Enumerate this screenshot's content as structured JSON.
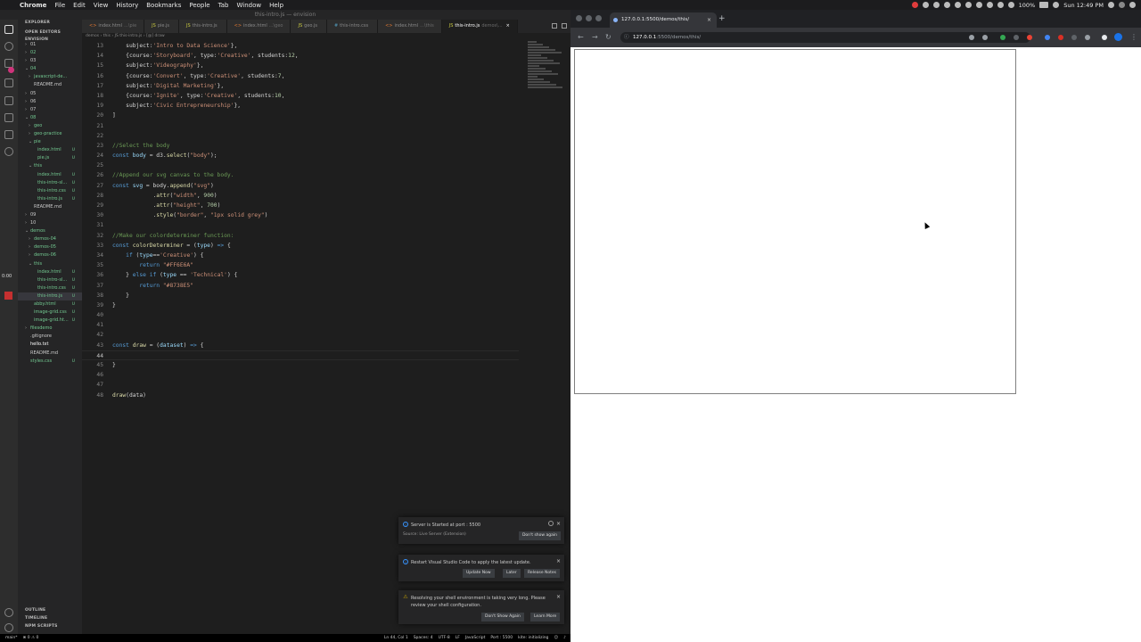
{
  "menubar": {
    "app": "Chrome",
    "items": [
      "File",
      "Edit",
      "View",
      "History",
      "Bookmarks",
      "People",
      "Tab",
      "Window",
      "Help"
    ],
    "battery": "100%",
    "clock": "Sun 12:49 PM"
  },
  "vscode": {
    "title": "this-intro.js — envision",
    "timer": "0:00",
    "explorer_label": "EXPLORER",
    "open_editors_label": "OPEN EDITORS",
    "workspace_label": "ENVISION",
    "tree": [
      {
        "label": "01",
        "indent": 1,
        "color": "#cccccc",
        "arrow": "›",
        "u": ""
      },
      {
        "label": "02",
        "indent": 1,
        "color": "#73c991",
        "arrow": "›",
        "u": ""
      },
      {
        "label": "03",
        "indent": 1,
        "color": "#cccccc",
        "arrow": "›",
        "u": ""
      },
      {
        "label": "04",
        "indent": 1,
        "color": "#73c991",
        "arrow": "⌄",
        "u": ""
      },
      {
        "label": "javascript-de...",
        "indent": 2,
        "color": "#73c991",
        "arrow": "›",
        "u": ""
      },
      {
        "label": "README.md",
        "indent": 2,
        "color": "#cccccc",
        "arrow": "",
        "u": ""
      },
      {
        "label": "05",
        "indent": 1,
        "color": "#cccccc",
        "arrow": "›",
        "u": ""
      },
      {
        "label": "06",
        "indent": 1,
        "color": "#cccccc",
        "arrow": "›",
        "u": ""
      },
      {
        "label": "07",
        "indent": 1,
        "color": "#cccccc",
        "arrow": "›",
        "u": ""
      },
      {
        "label": "08",
        "indent": 1,
        "color": "#73c991",
        "arrow": "⌄",
        "u": ""
      },
      {
        "label": "geo",
        "indent": 2,
        "color": "#73c991",
        "arrow": "›",
        "u": ""
      },
      {
        "label": "geo-practice",
        "indent": 2,
        "color": "#73c991",
        "arrow": "›",
        "u": ""
      },
      {
        "label": "pie",
        "indent": 2,
        "color": "#73c991",
        "arrow": "⌄",
        "u": ""
      },
      {
        "label": "index.html",
        "indent": 3,
        "color": "#73c991",
        "arrow": "",
        "u": "U"
      },
      {
        "label": "pie.js",
        "indent": 3,
        "color": "#73c991",
        "arrow": "",
        "u": "U"
      },
      {
        "label": "this",
        "indent": 2,
        "color": "#73c991",
        "arrow": "⌄",
        "u": ""
      },
      {
        "label": "index.html",
        "indent": 3,
        "color": "#73c991",
        "arrow": "",
        "u": "U"
      },
      {
        "label": "this-intro-sl...",
        "indent": 3,
        "color": "#73c991",
        "arrow": "",
        "u": "U"
      },
      {
        "label": "this-intro.css",
        "indent": 3,
        "color": "#73c991",
        "arrow": "",
        "u": "U"
      },
      {
        "label": "this-intro.js",
        "indent": 3,
        "color": "#73c991",
        "arrow": "",
        "u": "U"
      },
      {
        "label": "README.md",
        "indent": 2,
        "color": "#cccccc",
        "arrow": "",
        "u": ""
      },
      {
        "label": "09",
        "indent": 1,
        "color": "#cccccc",
        "arrow": "›",
        "u": ""
      },
      {
        "label": "10",
        "indent": 1,
        "color": "#cccccc",
        "arrow": "›",
        "u": ""
      },
      {
        "label": "demos",
        "indent": 1,
        "color": "#73c991",
        "arrow": "⌄",
        "u": ""
      },
      {
        "label": "demos-04",
        "indent": 2,
        "color": "#73c991",
        "arrow": "›",
        "u": ""
      },
      {
        "label": "demos-05",
        "indent": 2,
        "color": "#73c991",
        "arrow": "›",
        "u": ""
      },
      {
        "label": "demos-06",
        "indent": 2,
        "color": "#73c991",
        "arrow": "›",
        "u": ""
      },
      {
        "label": "this",
        "indent": 2,
        "color": "#73c991",
        "arrow": "⌄",
        "u": ""
      },
      {
        "label": "index.html",
        "indent": 3,
        "color": "#73c991",
        "arrow": "",
        "u": "U"
      },
      {
        "label": "this-intro-sl...",
        "indent": 3,
        "color": "#73c991",
        "arrow": "",
        "u": "U"
      },
      {
        "label": "this-intro.css",
        "indent": 3,
        "color": "#73c991",
        "arrow": "",
        "u": "U"
      },
      {
        "label": "this-intro.js",
        "indent": 3,
        "color": "#73c991",
        "arrow": "",
        "u": "U",
        "selected": true
      },
      {
        "label": "abby.html",
        "indent": 2,
        "color": "#73c991",
        "arrow": "",
        "u": "U"
      },
      {
        "label": "image-grid.css",
        "indent": 2,
        "color": "#73c991",
        "arrow": "",
        "u": "U"
      },
      {
        "label": "image-grid.ht...",
        "indent": 2,
        "color": "#73c991",
        "arrow": "",
        "u": "U"
      },
      {
        "label": "filesdemo",
        "indent": 1,
        "color": "#73c991",
        "arrow": "›",
        "u": ""
      },
      {
        "label": ".gitignore",
        "indent": 1,
        "color": "#cccccc",
        "arrow": "",
        "u": ""
      },
      {
        "label": "hello.txt",
        "indent": 1,
        "color": "#ffffff",
        "arrow": "",
        "u": ""
      },
      {
        "label": "README.md",
        "indent": 1,
        "color": "#cccccc",
        "arrow": "",
        "u": ""
      },
      {
        "label": "styles.css",
        "indent": 1,
        "color": "#73c991",
        "arrow": "",
        "u": "U"
      }
    ],
    "sidebar_bottom": [
      "OUTLINE",
      "TIMELINE",
      "NPM SCRIPTS"
    ],
    "tabs": [
      {
        "label": "index.html",
        "dim": "...\\pie",
        "kind": "html"
      },
      {
        "label": "pie.js",
        "dim": "",
        "kind": "js"
      },
      {
        "label": "this-intro.js",
        "dim": "",
        "kind": "js"
      },
      {
        "label": "index.html",
        "dim": "...\\geo",
        "kind": "html"
      },
      {
        "label": "geo.js",
        "dim": "",
        "kind": "js"
      },
      {
        "label": "this-intro.css",
        "dim": "",
        "kind": "css"
      },
      {
        "label": "index.html",
        "dim": "...\\this",
        "kind": "html"
      },
      {
        "label": "this-intro.js",
        "dim": "demos\\...",
        "kind": "js",
        "active": true
      }
    ],
    "breadcrumb": "demos › this › JS this-intro.js › [@] draw",
    "code_lines": [
      {
        "n": "13",
        "html": "    subject:<span class=\"c-str\">'Intro to Data Science'</span>},"
      },
      {
        "n": "14",
        "html": "    {course:<span class=\"c-str\">'Storyboard'</span>, type:<span class=\"c-str\">'Creative'</span>, students:<span class=\"c-num\">12</span>,"
      },
      {
        "n": "15",
        "html": "    subject:<span class=\"c-str\">'Videography'</span>},"
      },
      {
        "n": "16",
        "html": "    {course:<span class=\"c-str\">'Convert'</span>, type:<span class=\"c-str\">'Creative'</span>, students:<span class=\"c-num\">7</span>,"
      },
      {
        "n": "17",
        "html": "    subject:<span class=\"c-str\">'Digital Marketing'</span>},"
      },
      {
        "n": "18",
        "html": "    {course:<span class=\"c-str\">'Ignite'</span>, type:<span class=\"c-str\">'Creative'</span>, students:<span class=\"c-num\">10</span>,"
      },
      {
        "n": "19",
        "html": "    subject:<span class=\"c-str\">'Civic Entrepreneurship'</span>},"
      },
      {
        "n": "20",
        "html": "]"
      },
      {
        "n": "21",
        "html": ""
      },
      {
        "n": "22",
        "html": ""
      },
      {
        "n": "23",
        "html": "<span class=\"c-com\">//Select the body</span>"
      },
      {
        "n": "24",
        "html": "<span class=\"c-kw\">const</span> <span class=\"c-var\">body</span> = d3.<span class=\"c-fn\">select</span>(<span class=\"c-str\">\"body\"</span>);"
      },
      {
        "n": "25",
        "html": ""
      },
      {
        "n": "26",
        "html": "<span class=\"c-com\">//Append our svg canvas to the body.</span>"
      },
      {
        "n": "27",
        "html": "<span class=\"c-kw\">const</span> <span class=\"c-var\">svg</span> = body.<span class=\"c-fn\">append</span>(<span class=\"c-str\">\"svg\"</span>)"
      },
      {
        "n": "28",
        "html": "            .<span class=\"c-fn\">attr</span>(<span class=\"c-str\">\"width\"</span>, <span class=\"c-num\">900</span>)"
      },
      {
        "n": "29",
        "html": "            .<span class=\"c-fn\">attr</span>(<span class=\"c-str\">\"height\"</span>, <span class=\"c-num\">700</span>)"
      },
      {
        "n": "30",
        "html": "            .<span class=\"c-fn\">style</span>(<span class=\"c-str\">\"border\"</span>, <span class=\"c-str\">\"1px solid grey\"</span>)"
      },
      {
        "n": "31",
        "html": ""
      },
      {
        "n": "32",
        "html": "<span class=\"c-com\">//Make our colordeterminer function:</span>"
      },
      {
        "n": "33",
        "html": "<span class=\"c-kw\">const</span> <span class=\"c-fn\">colorDeterminer</span> = (<span class=\"c-var\">type</span>) <span class=\"c-kw\">=&gt;</span> {"
      },
      {
        "n": "34",
        "html": "    <span class=\"c-kw\">if</span> (<span class=\"c-var\">type</span>==<span class=\"c-str\">'Creative'</span>) {"
      },
      {
        "n": "35",
        "html": "        <span class=\"c-kw\">return</span> <span class=\"c-str\">\"#FF6E6A\"</span>"
      },
      {
        "n": "36",
        "html": "    } <span class=\"c-kw\">else if</span> (<span class=\"c-var\">type</span> == <span class=\"c-str\">'Technical'</span>) {"
      },
      {
        "n": "37",
        "html": "        <span class=\"c-kw\">return</span> <span class=\"c-str\">\"#8738E5\"</span>"
      },
      {
        "n": "38",
        "html": "    }"
      },
      {
        "n": "39",
        "html": "}"
      },
      {
        "n": "40",
        "html": ""
      },
      {
        "n": "41",
        "html": ""
      },
      {
        "n": "42",
        "html": ""
      },
      {
        "n": "43",
        "html": "<span class=\"c-kw\">const</span> <span class=\"c-fn\">draw</span> = (<span class=\"c-var\">dataset</span>) <span class=\"c-kw\">=&gt;</span> {"
      },
      {
        "n": "44",
        "html": "",
        "current": true
      },
      {
        "n": "45",
        "html": "}"
      },
      {
        "n": "46",
        "html": ""
      },
      {
        "n": "47",
        "html": ""
      },
      {
        "n": "48",
        "html": "<span class=\"c-fn\">draw</span>(data)"
      }
    ],
    "notifications": {
      "server": {
        "message": "Server is Started at port : 5500",
        "source": "Source: Live Server (Extension)",
        "button": "Don't show again"
      },
      "restart": {
        "message": "Restart Visual Studio Code to apply the latest update.",
        "buttons": [
          "Update Now",
          "Later",
          "Release Notes"
        ]
      },
      "shell": {
        "message": "Resolving your shell environment is taking very long. Please review your shell configuration.",
        "buttons": [
          "Don't Show Again",
          "Learn More"
        ]
      }
    },
    "status": {
      "branch": "main*",
      "problems": "⊗ 0 ⚠ 0",
      "position": "Ln 44, Col 1",
      "spaces": "Spaces: 4",
      "encoding": "UTF-8",
      "eol": "LF",
      "language": "JavaScript",
      "port": "Port : 5500",
      "kite": "kite: initializing"
    }
  },
  "browser": {
    "tab_title": "127.0.0.1:5500/demos/this/",
    "address_host": "127.0.0.1",
    "address_path": ":5500/demos/this/"
  }
}
